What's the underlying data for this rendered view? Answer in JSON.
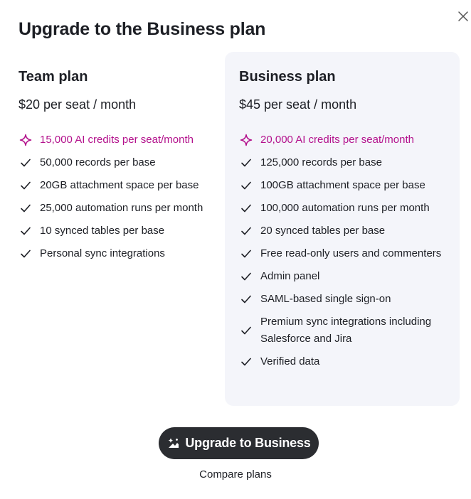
{
  "dialog": {
    "title": "Upgrade to the Business plan",
    "close_icon": "close-icon"
  },
  "colors": {
    "ai_accent": "#b3118c",
    "business_panel_bg": "#f4f5fa",
    "button_bg": "#2b2d31",
    "text": "#1d1f25"
  },
  "team": {
    "name": "Team plan",
    "price": "$20 per seat / month",
    "features": [
      {
        "icon": "sparkle-icon",
        "text": "15,000 AI credits per seat/month"
      },
      {
        "icon": "check-icon",
        "text": "50,000 records per base"
      },
      {
        "icon": "check-icon",
        "text": "20GB attachment space per base"
      },
      {
        "icon": "check-icon",
        "text": "25,000 automation runs per month"
      },
      {
        "icon": "check-icon",
        "text": "10 synced tables per base"
      },
      {
        "icon": "check-icon",
        "text": "Personal sync integrations"
      }
    ]
  },
  "business": {
    "name": "Business plan",
    "price": "$45 per seat / month",
    "features": [
      {
        "icon": "sparkle-icon",
        "text": "20,000 AI credits per seat/month"
      },
      {
        "icon": "check-icon",
        "text": "125,000 records per base"
      },
      {
        "icon": "check-icon",
        "text": "100GB attachment space per base"
      },
      {
        "icon": "check-icon",
        "text": "100,000 automation runs per month"
      },
      {
        "icon": "check-icon",
        "text": "20 synced tables per base"
      },
      {
        "icon": "check-icon",
        "text": "Free read-only users and commenters"
      },
      {
        "icon": "check-icon",
        "text": "Admin panel"
      },
      {
        "icon": "check-icon",
        "text": "SAML-based single sign-on"
      },
      {
        "icon": "check-icon",
        "text": "Premium sync integrations including Salesforce and Jira"
      },
      {
        "icon": "check-icon",
        "text": "Verified data"
      }
    ]
  },
  "actions": {
    "upgrade_label": "Upgrade to Business",
    "upgrade_icon": "sparkle-build-icon",
    "compare_label": "Compare plans"
  }
}
